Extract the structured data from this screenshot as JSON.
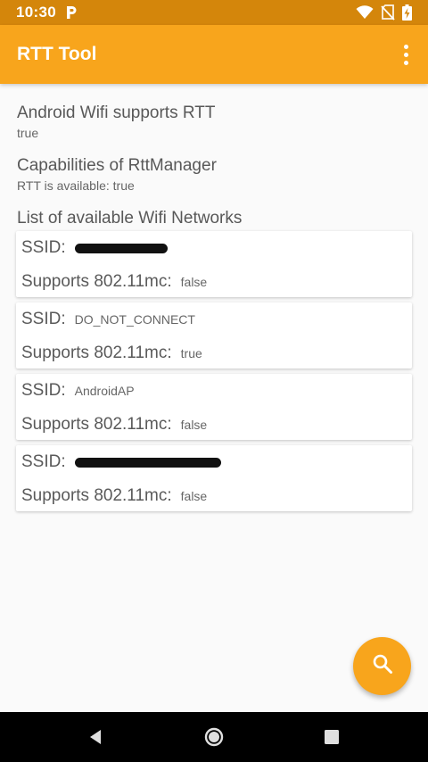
{
  "status_bar": {
    "time": "10:30",
    "icons": [
      "p-icon",
      "wifi-icon",
      "no-sim-icon",
      "battery-charging-icon"
    ]
  },
  "app_bar": {
    "title": "RTT Tool",
    "menu_icon": "more-vert-icon"
  },
  "sections": [
    {
      "title": "Android Wifi supports RTT",
      "value": "true"
    },
    {
      "title": "Capabilities of RttManager",
      "value": "RTT is available: true"
    },
    {
      "title": "List of available Wifi Networks"
    }
  ],
  "networks": {
    "ssid_label": "SSID:",
    "support_label": "Supports 802.11mc:",
    "items": [
      {
        "ssid": "",
        "ssid_redacted": true,
        "supports": "false"
      },
      {
        "ssid": "DO_NOT_CONNECT",
        "ssid_redacted": false,
        "supports": "true"
      },
      {
        "ssid": "AndroidAP",
        "ssid_redacted": false,
        "supports": "false"
      },
      {
        "ssid": "",
        "ssid_redacted": true,
        "supports": "false"
      }
    ]
  },
  "fab": {
    "icon": "search-icon"
  },
  "nav_bar": {
    "icons": [
      "back-icon",
      "home-icon",
      "recents-icon"
    ]
  },
  "colors": {
    "status_bar": "#d4860b",
    "app_bar": "#f8a51c",
    "accent": "#f8a51c",
    "background": "#fafafa"
  }
}
